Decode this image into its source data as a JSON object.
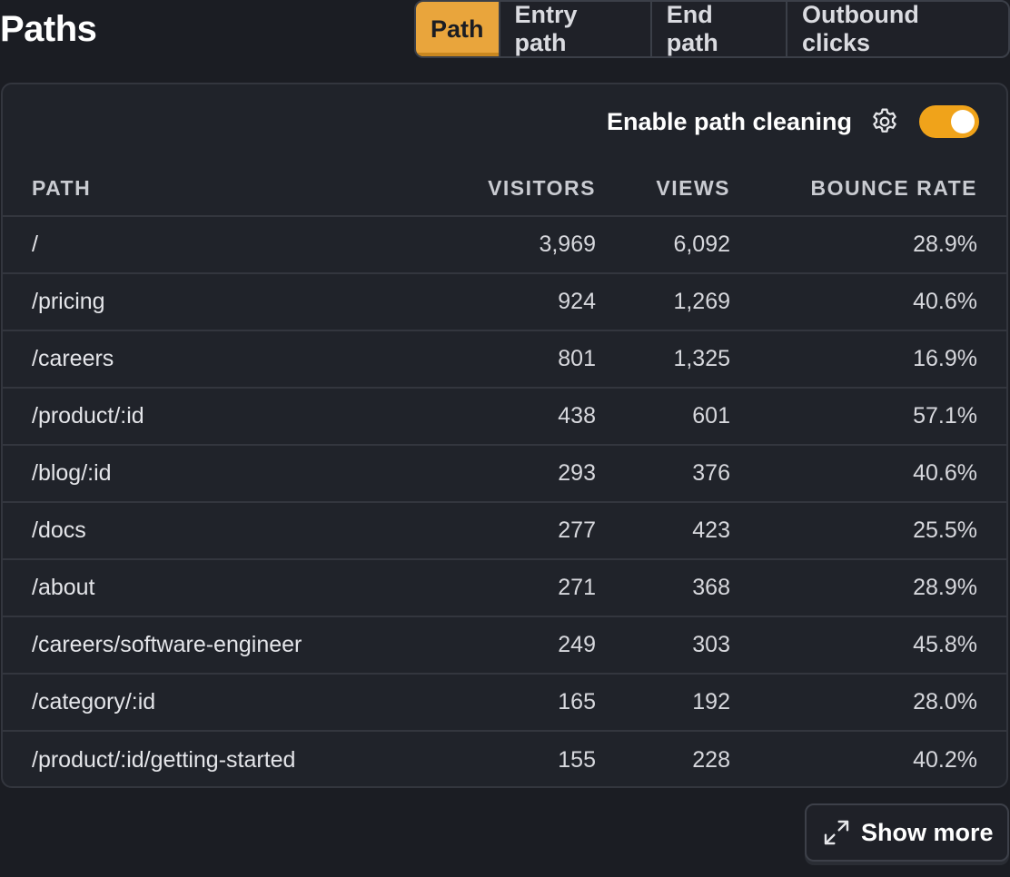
{
  "header": {
    "title": "Paths",
    "tabs": [
      {
        "label": "Path",
        "active": true
      },
      {
        "label": "Entry path",
        "active": false
      },
      {
        "label": "End path",
        "active": false
      },
      {
        "label": "Outbound clicks",
        "active": false
      }
    ]
  },
  "panel": {
    "cleaning_label": "Enable path cleaning",
    "cleaning_enabled": true,
    "settings_icon": "gear-icon",
    "columns": {
      "path": "PATH",
      "visitors": "VISITORS",
      "views": "VIEWS",
      "bounce_rate": "BOUNCE RATE"
    },
    "rows": [
      {
        "path": "/",
        "visitors": "3,969",
        "views": "6,092",
        "bounce_rate": "28.9%"
      },
      {
        "path": "/pricing",
        "visitors": "924",
        "views": "1,269",
        "bounce_rate": "40.6%"
      },
      {
        "path": "/careers",
        "visitors": "801",
        "views": "1,325",
        "bounce_rate": "16.9%"
      },
      {
        "path": "/product/:id",
        "visitors": "438",
        "views": "601",
        "bounce_rate": "57.1%"
      },
      {
        "path": "/blog/:id",
        "visitors": "293",
        "views": "376",
        "bounce_rate": "40.6%"
      },
      {
        "path": "/docs",
        "visitors": "277",
        "views": "423",
        "bounce_rate": "25.5%"
      },
      {
        "path": "/about",
        "visitors": "271",
        "views": "368",
        "bounce_rate": "28.9%"
      },
      {
        "path": "/careers/software-engineer",
        "visitors": "249",
        "views": "303",
        "bounce_rate": "45.8%"
      },
      {
        "path": "/category/:id",
        "visitors": "165",
        "views": "192",
        "bounce_rate": "28.0%"
      },
      {
        "path": "/product/:id/getting-started",
        "visitors": "155",
        "views": "228",
        "bounce_rate": "40.2%"
      }
    ]
  },
  "footer": {
    "show_more_label": "Show more",
    "show_more_icon": "expand-icon"
  },
  "colors": {
    "accent": "#e9a53c",
    "toggle_on": "#f0a31a",
    "background": "#1b1d23",
    "panel": "#20232a"
  }
}
